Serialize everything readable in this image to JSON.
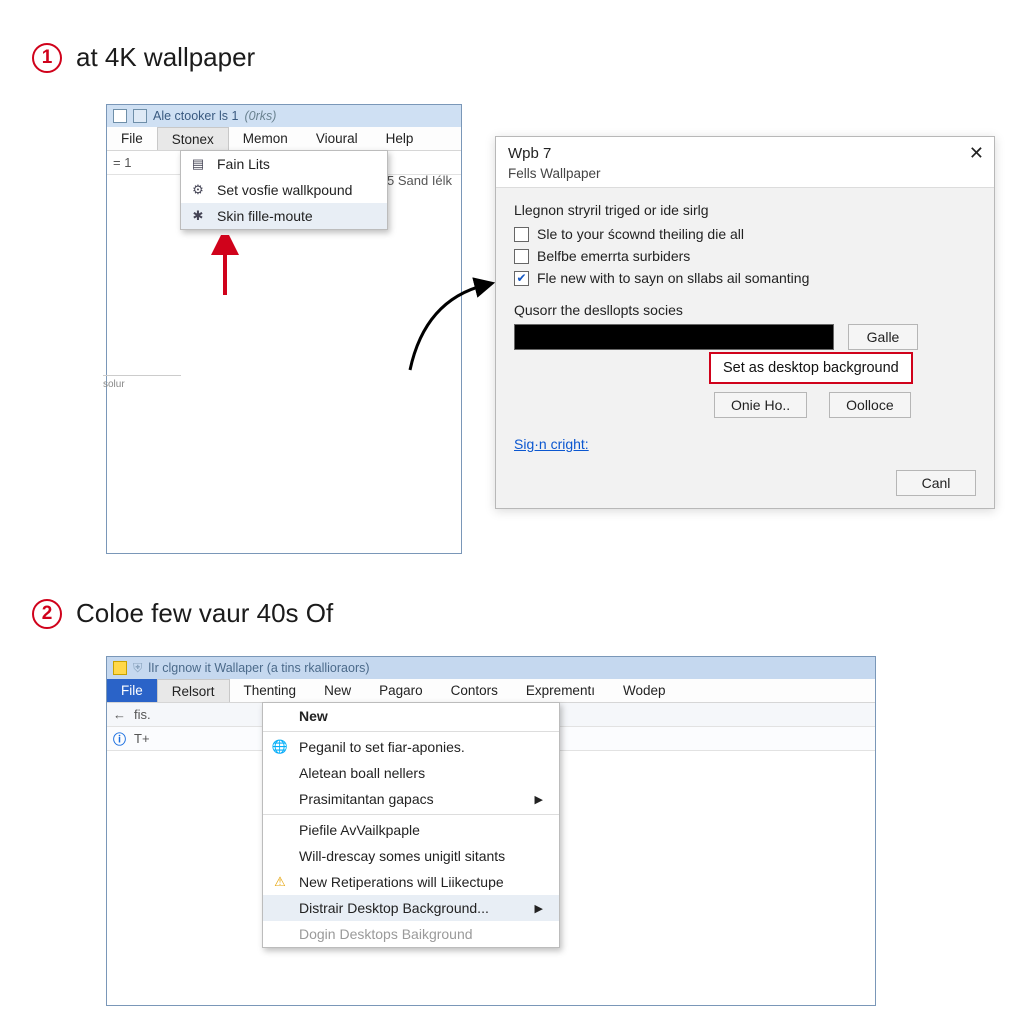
{
  "step1": {
    "num": "1",
    "text": "at 4K wallpaper",
    "window": {
      "title_a": "Ale ctooker ls 1",
      "title_b": "(0rks)",
      "menu": [
        "File",
        "Stonex",
        "Memon",
        "Vioural",
        "Help"
      ],
      "toolbar_left": "= 1",
      "toolbar_right": "5 Sand Iélk",
      "dropdown": [
        {
          "icon": "doc-icon",
          "label": "Fain Lits"
        },
        {
          "icon": "gear-icon",
          "label": "Set vosfie wallkpound"
        },
        {
          "icon": "star-icon",
          "label": "Skin fille-moute"
        }
      ],
      "side_text": "solur"
    }
  },
  "dialog": {
    "title": "Wpb 7",
    "tabs": "Fells  Wallpaper",
    "line1": "Llegnon stryril triged or ide sirlg",
    "chk1": "Sle to your ścownd theiling die all",
    "chk2": "Belfbe emerrta surbiders",
    "chk3": "Fle new with to sayn on sllabs ail somanting",
    "chk3_checked": true,
    "line2": "Qusorr the desllopts socies",
    "btn_right": "Galle",
    "highlight_btn": "Set as desktop background",
    "btn_a": "Onie Ho..",
    "btn_b": "Oolloce",
    "link": "Sig·n cright:",
    "cancel": "Canl"
  },
  "step2": {
    "num": "2",
    "text": "Coloe few vaur 40s Of",
    "window": {
      "title": "lIr clgnow it Wallaper (a tins rkallioraors)",
      "menu": [
        "File",
        "Relsort",
        "Thenting",
        "New",
        "Pagaro",
        "Contors",
        "Exprementı",
        "Wodep"
      ],
      "tool_left": "fis.",
      "tool_left2": "T+",
      "dropdown": [
        {
          "label": "New",
          "bold": true
        },
        {
          "label": "Peganil to set fiar-aponies.",
          "icon": "globe-icon"
        },
        {
          "label": "Aletean boall nellers"
        },
        {
          "label": "Prasimitantan gapacs",
          "sub": true
        },
        {
          "label": "Piefile AvVailkpaple"
        },
        {
          "label": "Will-drescay somes unigitl sitants"
        },
        {
          "label": "New Retiperations will Liikectupe",
          "icon": "warn-icon"
        },
        {
          "label": "Distrair Desktop Background...",
          "sub": true,
          "hl": true
        },
        {
          "label": "Dogin Desktops Baikground",
          "disabled": true
        }
      ]
    }
  }
}
